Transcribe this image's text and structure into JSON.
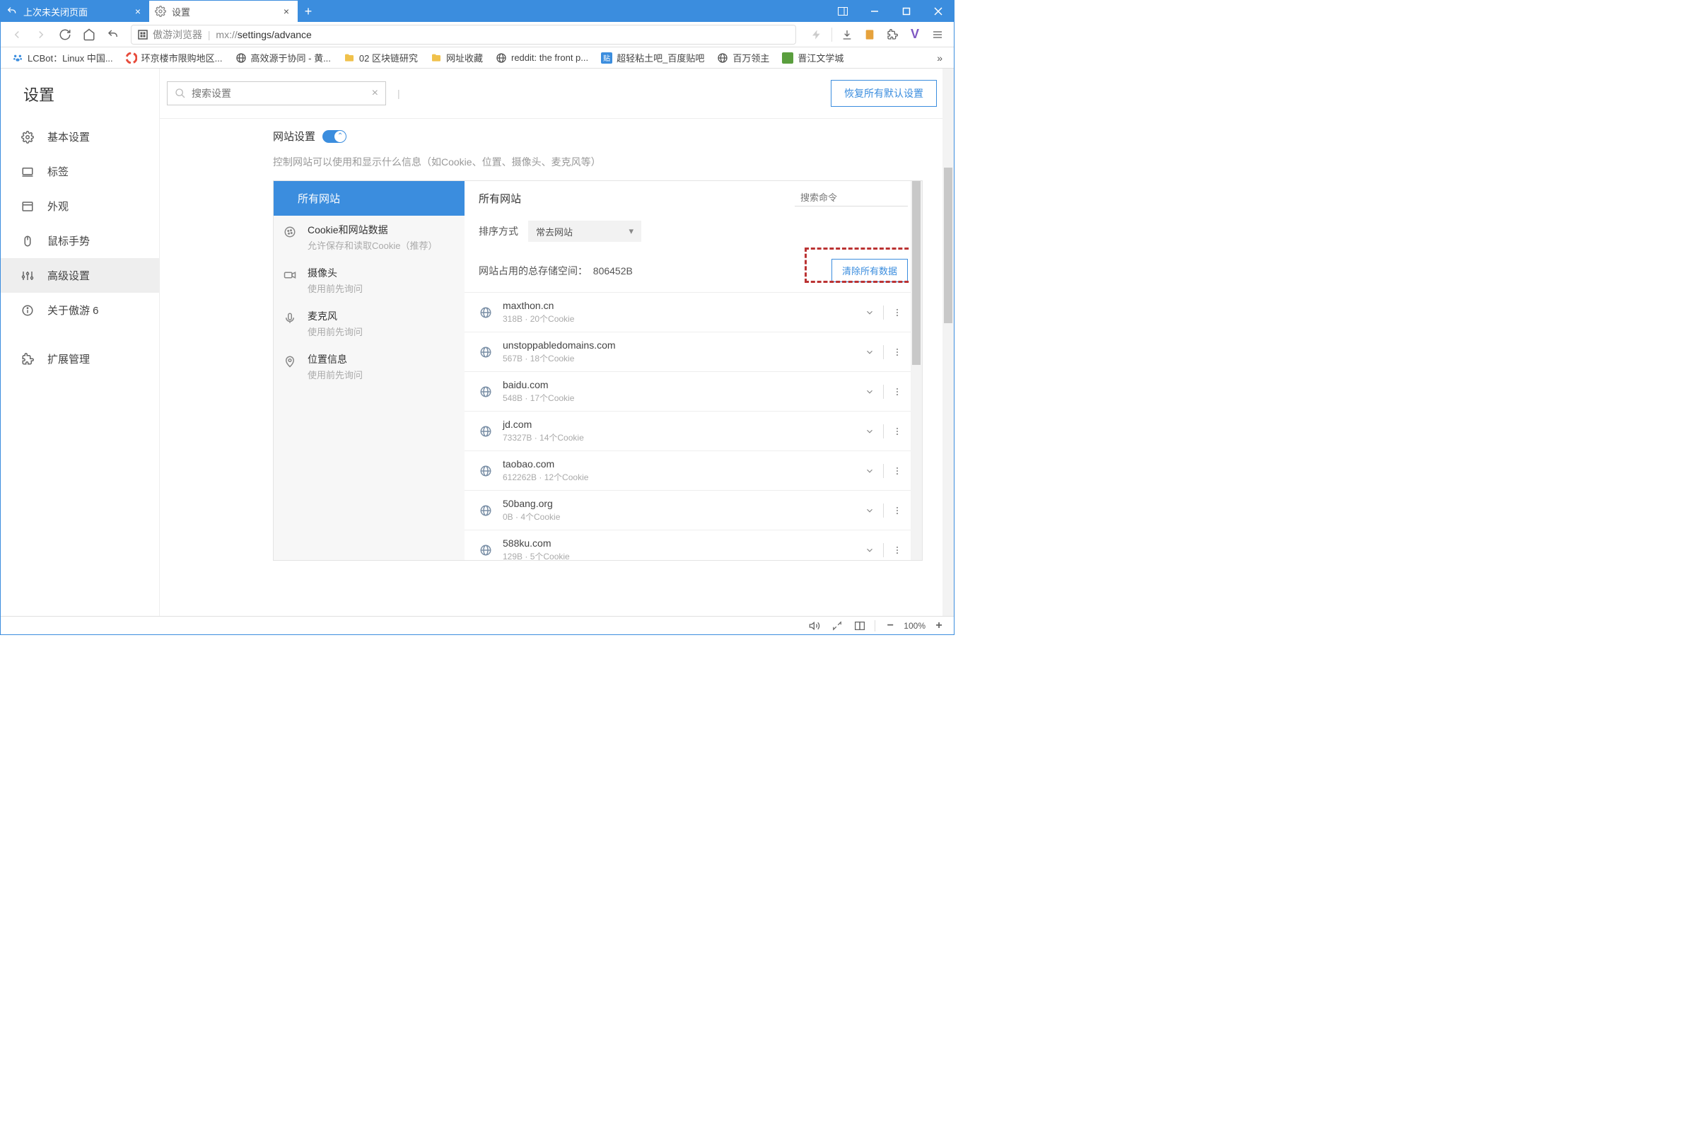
{
  "tabs": [
    {
      "label": "上次未关闭页面",
      "active": false
    },
    {
      "label": "设置",
      "active": true
    }
  ],
  "addressbar": {
    "app_name": "傲游浏览器",
    "url_prefix": "mx://",
    "url_path": "settings/advance"
  },
  "bookmarks": [
    {
      "label": "LCBot：Linux 中国...",
      "icon": "paw"
    },
    {
      "label": "环京楼市限购地区...",
      "icon": "color-circle"
    },
    {
      "label": "高效源于协同 - 黄...",
      "icon": "globe-dark"
    },
    {
      "label": "02 区块链研究",
      "icon": "folder"
    },
    {
      "label": "网址收藏",
      "icon": "folder"
    },
    {
      "label": "reddit: the front p...",
      "icon": "globe-dark"
    },
    {
      "label": "超轻粘土吧_百度贴吧",
      "icon": "blue-square"
    },
    {
      "label": "百万领主",
      "icon": "globe-dark"
    },
    {
      "label": "晋江文学城",
      "icon": "green-pic"
    }
  ],
  "sidebar_title": "设置",
  "search_placeholder": "搜索设置",
  "restore_defaults": "恢复所有默认设置",
  "sidebar_items": [
    {
      "label": "基本设置",
      "icon": "gear"
    },
    {
      "label": "标签",
      "icon": "laptop"
    },
    {
      "label": "外观",
      "icon": "window"
    },
    {
      "label": "鼠标手势",
      "icon": "mouse"
    },
    {
      "label": "高级设置",
      "icon": "sliders",
      "active": true
    },
    {
      "label": "关于傲游 6",
      "icon": "info"
    }
  ],
  "sidebar_ext": {
    "label": "扩展管理",
    "icon": "puzzle"
  },
  "section": {
    "title": "网站设置",
    "desc": "控制网站可以使用和显示什么信息（如Cookie、位置、摄像头、麦克风等）"
  },
  "panel_left": {
    "head": "所有网站",
    "items": [
      {
        "title": "Cookie和网站数据",
        "sub": "允许保存和读取Cookie（推荐）",
        "icon": "cookie"
      },
      {
        "title": "摄像头",
        "sub": "使用前先询问",
        "icon": "camera"
      },
      {
        "title": "麦克风",
        "sub": "使用前先询问",
        "icon": "mic"
      },
      {
        "title": "位置信息",
        "sub": "使用前先询问",
        "icon": "pin"
      }
    ]
  },
  "panel_right": {
    "title": "所有网站",
    "search_placeholder": "搜索命令",
    "sort_label": "排序方式",
    "sort_value": "常去网站",
    "storage_label": "网站占用的总存储空间：",
    "storage_value": "806452B",
    "clear_all": "清除所有数据",
    "cookie_word": "个Cookie",
    "sites": [
      {
        "domain": "maxthon.cn",
        "size": "318B",
        "cookies": 20
      },
      {
        "domain": "unstoppabledomains.com",
        "size": "567B",
        "cookies": 18
      },
      {
        "domain": "baidu.com",
        "size": "548B",
        "cookies": 17
      },
      {
        "domain": "jd.com",
        "size": "73327B",
        "cookies": 14
      },
      {
        "domain": "taobao.com",
        "size": "612262B",
        "cookies": 12
      },
      {
        "domain": "50bang.org",
        "size": "0B",
        "cookies": 4
      },
      {
        "domain": "588ku.com",
        "size": "129B",
        "cookies": 5
      }
    ]
  },
  "statusbar": {
    "zoom": "100%"
  }
}
